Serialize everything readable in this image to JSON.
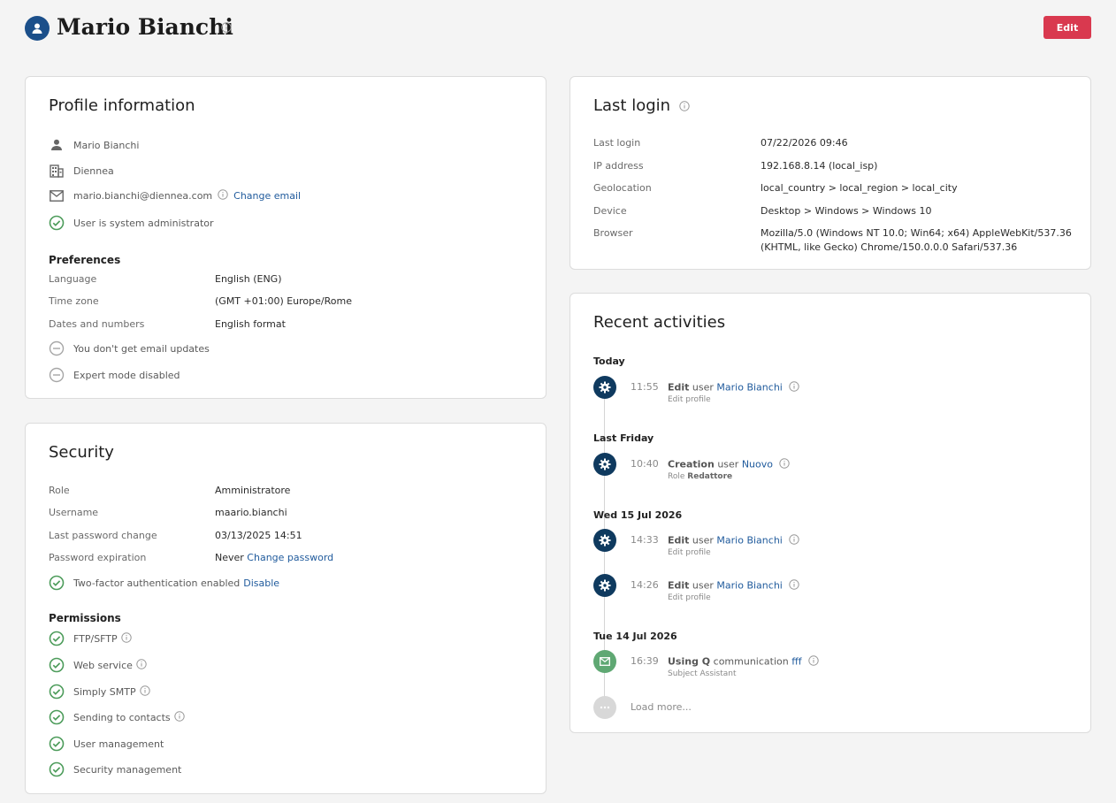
{
  "header": {
    "title": "Mario Bianchi",
    "edit_label": "Edit"
  },
  "profile": {
    "title": "Profile information",
    "name": "Mario Bianchi",
    "company": "Diennea",
    "email": "mario.bianchi@diennea.com",
    "change_email": "Change email",
    "admin_status": "User is system administrator",
    "preferences_title": "Preferences",
    "preferences": [
      {
        "label": "Language",
        "value": "English (ENG)"
      },
      {
        "label": "Time zone",
        "value": "(GMT +01:00) Europe/Rome"
      },
      {
        "label": "Dates and numbers",
        "value": "English format"
      }
    ],
    "email_updates": "You don't get email updates",
    "expert_mode": "Expert mode disabled"
  },
  "security": {
    "title": "Security",
    "rows": [
      {
        "label": "Role",
        "value": "Amministratore"
      },
      {
        "label": "Username",
        "value": "maario.bianchi"
      },
      {
        "label": "Last password change",
        "value": "03/13/2025 14:51"
      },
      {
        "label": "Password expiration",
        "value": "Never"
      }
    ],
    "change_password": "Change password",
    "two_factor": "Two-factor authentication enabled",
    "disable": "Disable",
    "permissions_title": "Permissions",
    "permissions": [
      "FTP/SFTP",
      "Web service",
      "Simply SMTP",
      "Sending to contacts",
      "User management",
      "Security management"
    ]
  },
  "last_login": {
    "title": "Last login",
    "rows": [
      {
        "label": "Last login",
        "value": "07/22/2026 09:46"
      },
      {
        "label": "IP address",
        "value": "192.168.8.14 (local_isp)"
      },
      {
        "label": "Geolocation",
        "value": "local_country > local_region > local_city"
      },
      {
        "label": "Device",
        "value": "Desktop > Windows > Windows 10"
      },
      {
        "label": "Browser",
        "value": "Mozilla/5.0 (Windows NT 10.0; Win64; x64) AppleWebKit/537.36",
        "value2": "(KHTML, like Gecko) Chrome/150.0.0.0 Safari/537.36"
      }
    ]
  },
  "activities": {
    "title": "Recent activities",
    "groups": [
      {
        "date": "Today",
        "items": [
          {
            "time": "11:55",
            "action": "Edit",
            "object": "user",
            "target": "Mario Bianchi",
            "detail": "Edit profile",
            "detail_bold": ""
          }
        ]
      },
      {
        "date": "Last Friday",
        "items": [
          {
            "time": "10:40",
            "action": "Creation",
            "object": "user",
            "target": "Nuovo",
            "detail": "Role",
            "detail_bold": "Redattore"
          }
        ]
      },
      {
        "date": "Wed 15 Jul 2026",
        "items": [
          {
            "time": "14:33",
            "action": "Edit",
            "object": "user",
            "target": "Mario Bianchi",
            "detail": "Edit profile",
            "detail_bold": ""
          },
          {
            "time": "14:26",
            "action": "Edit",
            "object": "user",
            "target": "Mario Bianchi",
            "detail": "Edit profile",
            "detail_bold": ""
          }
        ]
      },
      {
        "date": "Tue 14 Jul 2026",
        "items": [
          {
            "time": "16:39",
            "action": "Using Q",
            "object": "communication",
            "target": "fff",
            "detail": "Subject Assistant",
            "detail_bold": ""
          }
        ]
      }
    ],
    "load_more": "Load more...",
    "colors": {
      "gear": "#0f3a5f",
      "mail": "#5fa873",
      "more": "#d8d8d8"
    }
  }
}
